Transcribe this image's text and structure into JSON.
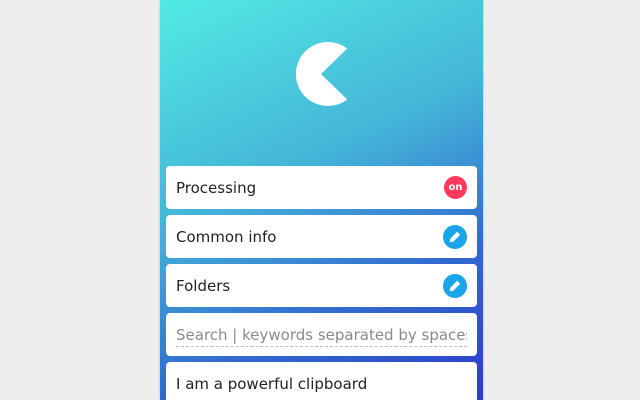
{
  "menu": {
    "processing": {
      "label": "Processing",
      "badge": "on"
    },
    "common_info": {
      "label": "Common info",
      "action_icon": "edit-icon"
    },
    "folders": {
      "label": "Folders",
      "action_icon": "edit-icon"
    }
  },
  "search": {
    "value": "",
    "placeholder": "Search | keywords separated by spaces"
  },
  "clips": [
    {
      "text": "I am a powerful clipboard"
    }
  ],
  "colors": {
    "gradient_start": "#52eae3",
    "gradient_end": "#2b3cc8",
    "badge_on": "#ff3a5a",
    "edit_button": "#1aa4ec"
  },
  "icons": {
    "logo": "pacman-logo-icon"
  }
}
